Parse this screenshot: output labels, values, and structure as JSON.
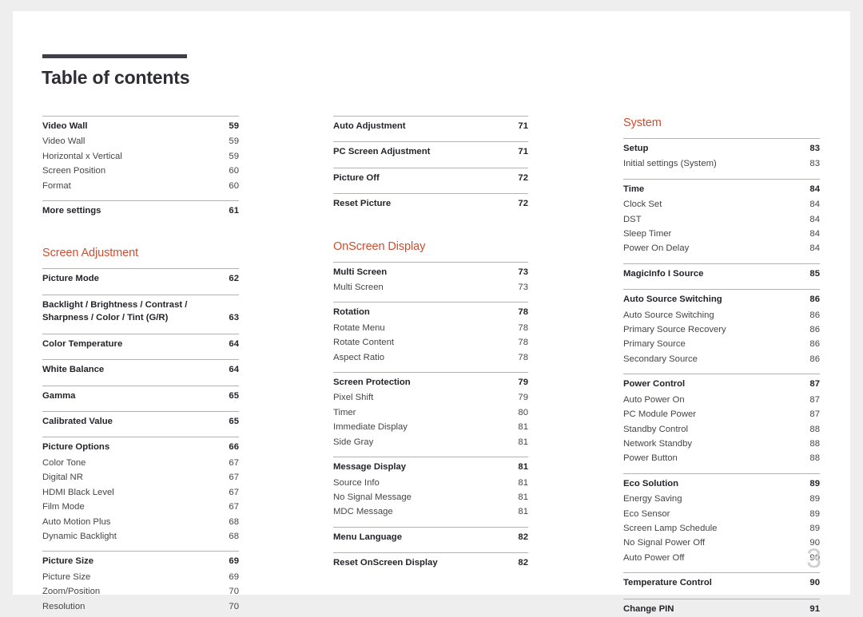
{
  "document": {
    "title": "Table of contents",
    "folio": "3",
    "accent_color": "#cf4d30",
    "rule_color": "#413f4a"
  },
  "columns": [
    {
      "name": "column-1",
      "blocks": [
        {
          "type": "group",
          "rows": [
            {
              "label": "Video Wall",
              "page": "59",
              "level": "head"
            },
            {
              "label": "Video Wall",
              "page": "59",
              "level": "sub"
            },
            {
              "label": "Horizontal x Vertical",
              "page": "59",
              "level": "sub"
            },
            {
              "label": "Screen Position",
              "page": "60",
              "level": "sub"
            },
            {
              "label": "Format",
              "page": "60",
              "level": "sub"
            }
          ]
        },
        {
          "type": "group",
          "rows": [
            {
              "label": "More settings",
              "page": "61",
              "level": "head"
            }
          ]
        },
        {
          "type": "section",
          "heading": "Screen Adjustment"
        },
        {
          "type": "group",
          "rows": [
            {
              "label": "Picture Mode",
              "page": "62",
              "level": "head"
            }
          ]
        },
        {
          "type": "group",
          "rows": [
            {
              "label": "Backlight / Brightness / Contrast /\nSharpness / Color / Tint (G/R)",
              "page": "63",
              "level": "head",
              "multiline": true
            }
          ]
        },
        {
          "type": "group",
          "rows": [
            {
              "label": "Color Temperature",
              "page": "64",
              "level": "head"
            }
          ]
        },
        {
          "type": "group",
          "rows": [
            {
              "label": "White Balance",
              "page": "64",
              "level": "head"
            }
          ]
        },
        {
          "type": "group",
          "rows": [
            {
              "label": "Gamma",
              "page": "65",
              "level": "head"
            }
          ]
        },
        {
          "type": "group",
          "rows": [
            {
              "label": "Calibrated Value",
              "page": "65",
              "level": "head"
            }
          ]
        },
        {
          "type": "group",
          "rows": [
            {
              "label": "Picture Options",
              "page": "66",
              "level": "head"
            },
            {
              "label": "Color Tone",
              "page": "67",
              "level": "sub"
            },
            {
              "label": "Digital NR",
              "page": "67",
              "level": "sub"
            },
            {
              "label": "HDMI Black Level",
              "page": "67",
              "level": "sub"
            },
            {
              "label": "Film Mode",
              "page": "67",
              "level": "sub"
            },
            {
              "label": "Auto Motion Plus",
              "page": "68",
              "level": "sub"
            },
            {
              "label": "Dynamic Backlight",
              "page": "68",
              "level": "sub"
            }
          ]
        },
        {
          "type": "group",
          "rows": [
            {
              "label": "Picture Size",
              "page": "69",
              "level": "head"
            },
            {
              "label": "Picture Size",
              "page": "69",
              "level": "sub"
            },
            {
              "label": "Zoom/Position",
              "page": "70",
              "level": "sub"
            },
            {
              "label": "Resolution",
              "page": "70",
              "level": "sub"
            }
          ]
        }
      ]
    },
    {
      "name": "column-2",
      "blocks": [
        {
          "type": "group",
          "rows": [
            {
              "label": "Auto Adjustment",
              "page": "71",
              "level": "head"
            }
          ]
        },
        {
          "type": "group",
          "rows": [
            {
              "label": "PC Screen Adjustment",
              "page": "71",
              "level": "head"
            }
          ]
        },
        {
          "type": "group",
          "rows": [
            {
              "label": "Picture Off",
              "page": "72",
              "level": "head"
            }
          ]
        },
        {
          "type": "group",
          "rows": [
            {
              "label": "Reset Picture",
              "page": "72",
              "level": "head"
            }
          ]
        },
        {
          "type": "section",
          "heading": "OnScreen Display"
        },
        {
          "type": "group",
          "rows": [
            {
              "label": "Multi Screen",
              "page": "73",
              "level": "head"
            },
            {
              "label": "Multi Screen",
              "page": "73",
              "level": "sub"
            }
          ]
        },
        {
          "type": "group",
          "rows": [
            {
              "label": "Rotation",
              "page": "78",
              "level": "head"
            },
            {
              "label": "Rotate Menu",
              "page": "78",
              "level": "sub"
            },
            {
              "label": "Rotate Content",
              "page": "78",
              "level": "sub"
            },
            {
              "label": "Aspect Ratio",
              "page": "78",
              "level": "sub"
            }
          ]
        },
        {
          "type": "group",
          "rows": [
            {
              "label": "Screen Protection",
              "page": "79",
              "level": "head"
            },
            {
              "label": "Pixel Shift",
              "page": "79",
              "level": "sub"
            },
            {
              "label": "Timer",
              "page": "80",
              "level": "sub"
            },
            {
              "label": "Immediate Display",
              "page": "81",
              "level": "sub"
            },
            {
              "label": "Side Gray",
              "page": "81",
              "level": "sub"
            }
          ]
        },
        {
          "type": "group",
          "rows": [
            {
              "label": "Message Display",
              "page": "81",
              "level": "head"
            },
            {
              "label": "Source Info",
              "page": "81",
              "level": "sub"
            },
            {
              "label": "No Signal Message",
              "page": "81",
              "level": "sub"
            },
            {
              "label": "MDC Message",
              "page": "81",
              "level": "sub"
            }
          ]
        },
        {
          "type": "group",
          "rows": [
            {
              "label": "Menu Language",
              "page": "82",
              "level": "head"
            }
          ]
        },
        {
          "type": "group",
          "rows": [
            {
              "label": "Reset OnScreen Display",
              "page": "82",
              "level": "head"
            }
          ]
        }
      ]
    },
    {
      "name": "column-3",
      "blocks": [
        {
          "type": "section",
          "heading": "System"
        },
        {
          "type": "group",
          "rows": [
            {
              "label": "Setup",
              "page": "83",
              "level": "head"
            },
            {
              "label": "Initial settings (System)",
              "page": "83",
              "level": "sub"
            }
          ]
        },
        {
          "type": "group",
          "rows": [
            {
              "label": "Time",
              "page": "84",
              "level": "head"
            },
            {
              "label": "Clock Set",
              "page": "84",
              "level": "sub"
            },
            {
              "label": "DST",
              "page": "84",
              "level": "sub"
            },
            {
              "label": "Sleep Timer",
              "page": "84",
              "level": "sub"
            },
            {
              "label": "Power On Delay",
              "page": "84",
              "level": "sub"
            }
          ]
        },
        {
          "type": "group",
          "rows": [
            {
              "label": "MagicInfo I Source",
              "page": "85",
              "level": "head"
            }
          ]
        },
        {
          "type": "group",
          "rows": [
            {
              "label": "Auto Source Switching",
              "page": "86",
              "level": "head"
            },
            {
              "label": "Auto Source Switching",
              "page": "86",
              "level": "sub"
            },
            {
              "label": "Primary Source Recovery",
              "page": "86",
              "level": "sub"
            },
            {
              "label": "Primary Source",
              "page": "86",
              "level": "sub"
            },
            {
              "label": "Secondary Source",
              "page": "86",
              "level": "sub"
            }
          ]
        },
        {
          "type": "group",
          "rows": [
            {
              "label": "Power Control",
              "page": "87",
              "level": "head"
            },
            {
              "label": "Auto Power On",
              "page": "87",
              "level": "sub"
            },
            {
              "label": "PC Module Power",
              "page": "87",
              "level": "sub"
            },
            {
              "label": "Standby Control",
              "page": "88",
              "level": "sub"
            },
            {
              "label": "Network Standby",
              "page": "88",
              "level": "sub"
            },
            {
              "label": "Power Button",
              "page": "88",
              "level": "sub"
            }
          ]
        },
        {
          "type": "group",
          "rows": [
            {
              "label": "Eco Solution",
              "page": "89",
              "level": "head"
            },
            {
              "label": "Energy Saving",
              "page": "89",
              "level": "sub"
            },
            {
              "label": "Eco Sensor",
              "page": "89",
              "level": "sub"
            },
            {
              "label": "Screen Lamp Schedule",
              "page": "89",
              "level": "sub"
            },
            {
              "label": "No Signal Power Off",
              "page": "90",
              "level": "sub"
            },
            {
              "label": "Auto Power Off",
              "page": "90",
              "level": "sub"
            }
          ]
        },
        {
          "type": "group",
          "rows": [
            {
              "label": "Temperature Control",
              "page": "90",
              "level": "head"
            }
          ]
        },
        {
          "type": "group",
          "rows": [
            {
              "label": "Change PIN",
              "page": "91",
              "level": "head"
            }
          ]
        }
      ]
    }
  ]
}
